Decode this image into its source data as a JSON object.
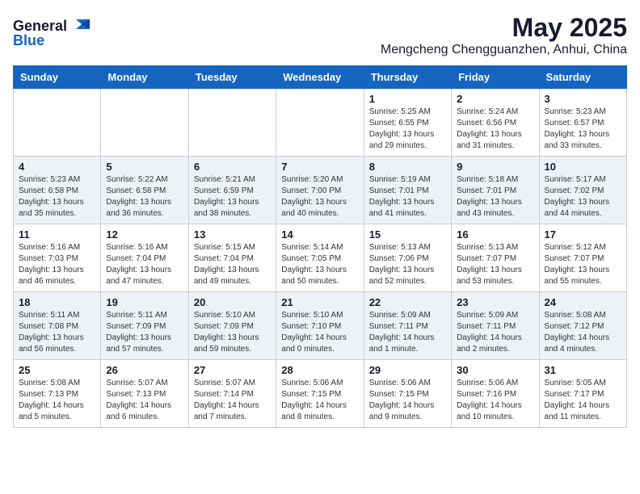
{
  "header": {
    "logo_general": "General",
    "logo_blue": "Blue",
    "month_year": "May 2025",
    "location": "Mengcheng Chengguanzhen, Anhui, China"
  },
  "days_of_week": [
    "Sunday",
    "Monday",
    "Tuesday",
    "Wednesday",
    "Thursday",
    "Friday",
    "Saturday"
  ],
  "weeks": [
    [
      {
        "day": "",
        "info": ""
      },
      {
        "day": "",
        "info": ""
      },
      {
        "day": "",
        "info": ""
      },
      {
        "day": "",
        "info": ""
      },
      {
        "day": "1",
        "info": "Sunrise: 5:25 AM\nSunset: 6:55 PM\nDaylight: 13 hours\nand 29 minutes."
      },
      {
        "day": "2",
        "info": "Sunrise: 5:24 AM\nSunset: 6:56 PM\nDaylight: 13 hours\nand 31 minutes."
      },
      {
        "day": "3",
        "info": "Sunrise: 5:23 AM\nSunset: 6:57 PM\nDaylight: 13 hours\nand 33 minutes."
      }
    ],
    [
      {
        "day": "4",
        "info": "Sunrise: 5:23 AM\nSunset: 6:58 PM\nDaylight: 13 hours\nand 35 minutes."
      },
      {
        "day": "5",
        "info": "Sunrise: 5:22 AM\nSunset: 6:58 PM\nDaylight: 13 hours\nand 36 minutes."
      },
      {
        "day": "6",
        "info": "Sunrise: 5:21 AM\nSunset: 6:59 PM\nDaylight: 13 hours\nand 38 minutes."
      },
      {
        "day": "7",
        "info": "Sunrise: 5:20 AM\nSunset: 7:00 PM\nDaylight: 13 hours\nand 40 minutes."
      },
      {
        "day": "8",
        "info": "Sunrise: 5:19 AM\nSunset: 7:01 PM\nDaylight: 13 hours\nand 41 minutes."
      },
      {
        "day": "9",
        "info": "Sunrise: 5:18 AM\nSunset: 7:01 PM\nDaylight: 13 hours\nand 43 minutes."
      },
      {
        "day": "10",
        "info": "Sunrise: 5:17 AM\nSunset: 7:02 PM\nDaylight: 13 hours\nand 44 minutes."
      }
    ],
    [
      {
        "day": "11",
        "info": "Sunrise: 5:16 AM\nSunset: 7:03 PM\nDaylight: 13 hours\nand 46 minutes."
      },
      {
        "day": "12",
        "info": "Sunrise: 5:16 AM\nSunset: 7:04 PM\nDaylight: 13 hours\nand 47 minutes."
      },
      {
        "day": "13",
        "info": "Sunrise: 5:15 AM\nSunset: 7:04 PM\nDaylight: 13 hours\nand 49 minutes."
      },
      {
        "day": "14",
        "info": "Sunrise: 5:14 AM\nSunset: 7:05 PM\nDaylight: 13 hours\nand 50 minutes."
      },
      {
        "day": "15",
        "info": "Sunrise: 5:13 AM\nSunset: 7:06 PM\nDaylight: 13 hours\nand 52 minutes."
      },
      {
        "day": "16",
        "info": "Sunrise: 5:13 AM\nSunset: 7:07 PM\nDaylight: 13 hours\nand 53 minutes."
      },
      {
        "day": "17",
        "info": "Sunrise: 5:12 AM\nSunset: 7:07 PM\nDaylight: 13 hours\nand 55 minutes."
      }
    ],
    [
      {
        "day": "18",
        "info": "Sunrise: 5:11 AM\nSunset: 7:08 PM\nDaylight: 13 hours\nand 56 minutes."
      },
      {
        "day": "19",
        "info": "Sunrise: 5:11 AM\nSunset: 7:09 PM\nDaylight: 13 hours\nand 57 minutes."
      },
      {
        "day": "20",
        "info": "Sunrise: 5:10 AM\nSunset: 7:09 PM\nDaylight: 13 hours\nand 59 minutes."
      },
      {
        "day": "21",
        "info": "Sunrise: 5:10 AM\nSunset: 7:10 PM\nDaylight: 14 hours\nand 0 minutes."
      },
      {
        "day": "22",
        "info": "Sunrise: 5:09 AM\nSunset: 7:11 PM\nDaylight: 14 hours\nand 1 minute."
      },
      {
        "day": "23",
        "info": "Sunrise: 5:09 AM\nSunset: 7:11 PM\nDaylight: 14 hours\nand 2 minutes."
      },
      {
        "day": "24",
        "info": "Sunrise: 5:08 AM\nSunset: 7:12 PM\nDaylight: 14 hours\nand 4 minutes."
      }
    ],
    [
      {
        "day": "25",
        "info": "Sunrise: 5:08 AM\nSunset: 7:13 PM\nDaylight: 14 hours\nand 5 minutes."
      },
      {
        "day": "26",
        "info": "Sunrise: 5:07 AM\nSunset: 7:13 PM\nDaylight: 14 hours\nand 6 minutes."
      },
      {
        "day": "27",
        "info": "Sunrise: 5:07 AM\nSunset: 7:14 PM\nDaylight: 14 hours\nand 7 minutes."
      },
      {
        "day": "28",
        "info": "Sunrise: 5:06 AM\nSunset: 7:15 PM\nDaylight: 14 hours\nand 8 minutes."
      },
      {
        "day": "29",
        "info": "Sunrise: 5:06 AM\nSunset: 7:15 PM\nDaylight: 14 hours\nand 9 minutes."
      },
      {
        "day": "30",
        "info": "Sunrise: 5:06 AM\nSunset: 7:16 PM\nDaylight: 14 hours\nand 10 minutes."
      },
      {
        "day": "31",
        "info": "Sunrise: 5:05 AM\nSunset: 7:17 PM\nDaylight: 14 hours\nand 11 minutes."
      }
    ]
  ]
}
